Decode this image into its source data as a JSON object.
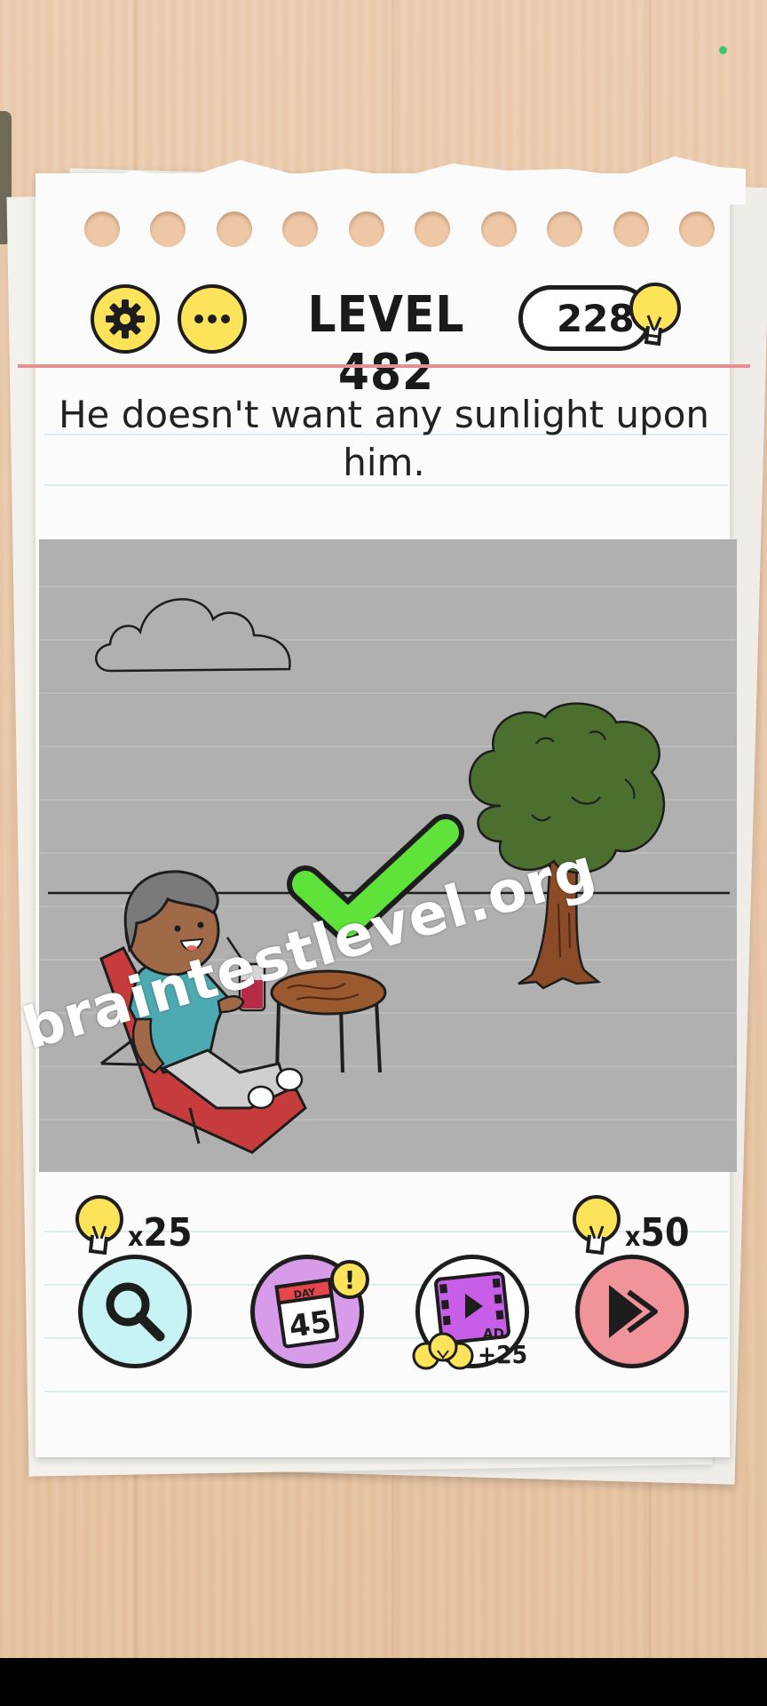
{
  "header": {
    "settings_icon": "gear-icon",
    "more_icon": "ellipsis-icon",
    "level_label": "LEVEL 482",
    "hint_count": "228",
    "hint_icon": "lightbulb-icon"
  },
  "question": {
    "text": "He doesn't want any sunlight upon him."
  },
  "scene": {
    "background": "#b0b0b0",
    "result_icon": "checkmark-icon",
    "check_color": "#5fe23a",
    "tree_color": "#4b6f2f"
  },
  "watermark": "braintestlevel.org",
  "tools": {
    "search": {
      "cost_prefix": "x",
      "cost": "25",
      "icon": "search-icon",
      "color": "#c8f3f5"
    },
    "daily": {
      "day_label": "DAY",
      "day_number": "45",
      "badge": "!",
      "icon": "calendar-icon",
      "color": "#d89be9"
    },
    "video": {
      "ad_label": "AD",
      "reward": "+25",
      "icon": "video-ad-icon"
    },
    "skip": {
      "cost_prefix": "x",
      "cost": "50",
      "icon": "skip-icon",
      "color": "#f1949a"
    }
  },
  "colors": {
    "accent_yellow": "#fce35a",
    "margin_line": "#e48f92"
  }
}
